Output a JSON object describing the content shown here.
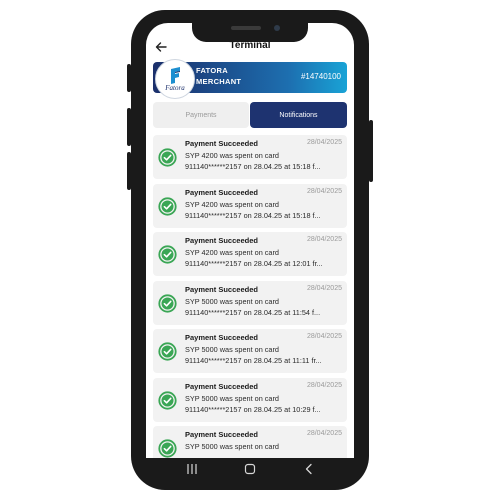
{
  "topbar": {
    "title": "Terminal",
    "back_icon": "back-arrow-icon"
  },
  "merchant": {
    "logo_text": "Fatora",
    "logo_small": "AAA",
    "name": "FATORA",
    "type": "MERCHANT",
    "terminal_id": "#14740100"
  },
  "tabs": {
    "payments": "Payments",
    "notifications": "Notifications",
    "active": "Notifications"
  },
  "colors": {
    "accent": "#1e3370",
    "success": "#3aa655",
    "card_bg": "#f2f2f2"
  },
  "notifications": [
    {
      "title": "Payment Succeeded",
      "date": "28/04/2025",
      "line1": "SYP 4200 was spent on card",
      "line2": "911140******2157 on 28.04.25 at 15:18 f..."
    },
    {
      "title": "Payment Succeeded",
      "date": "28/04/2025",
      "line1": "SYP 4200 was spent on card",
      "line2": "911140******2157 on 28.04.25 at 15:18 f..."
    },
    {
      "title": "Payment Succeeded",
      "date": "28/04/2025",
      "line1": "SYP 4200 was spent on card",
      "line2": "911140******2157 on 28.04.25 at 12:01 fr..."
    },
    {
      "title": "Payment Succeeded",
      "date": "28/04/2025",
      "line1": "SYP 5000 was spent on card",
      "line2": "911140******2157 on 28.04.25 at 11:54 f..."
    },
    {
      "title": "Payment Succeeded",
      "date": "28/04/2025",
      "line1": "SYP 5000 was spent on card",
      "line2": "911140******2157 on 28.04.25 at 11:11 fr..."
    },
    {
      "title": "Payment Succeeded",
      "date": "28/04/2025",
      "line1": "SYP 5000 was spent on card",
      "line2": "911140******2157 on 28.04.25 at 10:29 f..."
    },
    {
      "title": "Payment Succeeded",
      "date": "28/04/2025",
      "line1": "SYP 5000 was spent on card",
      "line2": ""
    }
  ],
  "navbar": {
    "recents_icon": "recents-icon",
    "home_icon": "home-icon",
    "back_icon": "nav-back-icon"
  }
}
